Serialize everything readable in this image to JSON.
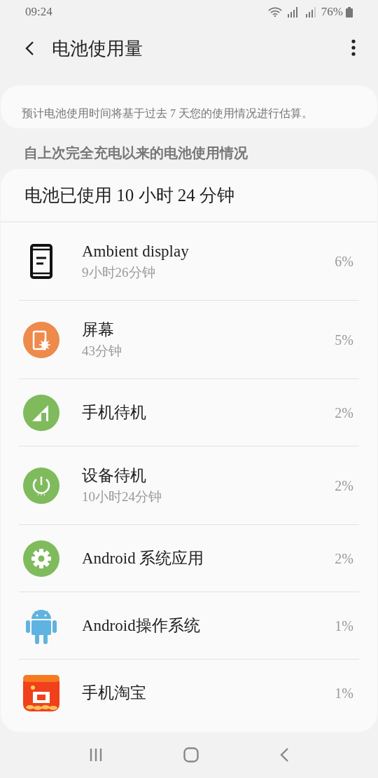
{
  "status_bar": {
    "time": "09:24",
    "battery": "76%"
  },
  "app_bar": {
    "title": "电池使用量"
  },
  "info": "预计电池使用时间将基于过去 7 天您的使用情况进行估算。",
  "section_header": "自上次完全充电以来的电池使用情况",
  "usage": {
    "heading": "电池已使用 10 小时 24 分钟",
    "items": [
      {
        "kind": "ambient",
        "name": "Ambient display",
        "duration": "9小时26分钟",
        "percent": "6%"
      },
      {
        "kind": "screen",
        "name": "屏幕",
        "duration": "43分钟",
        "percent": "5%"
      },
      {
        "kind": "cell",
        "name": "手机待机",
        "percent": "2%"
      },
      {
        "kind": "device",
        "name": "设备待机",
        "duration": "10小时24分钟",
        "percent": "2%"
      },
      {
        "kind": "system",
        "name": "Android 系统应用",
        "percent": "2%"
      },
      {
        "kind": "android",
        "name": "Android操作系统",
        "percent": "1%"
      },
      {
        "kind": "app",
        "name": "手机淘宝",
        "percent": "1%"
      }
    ]
  }
}
